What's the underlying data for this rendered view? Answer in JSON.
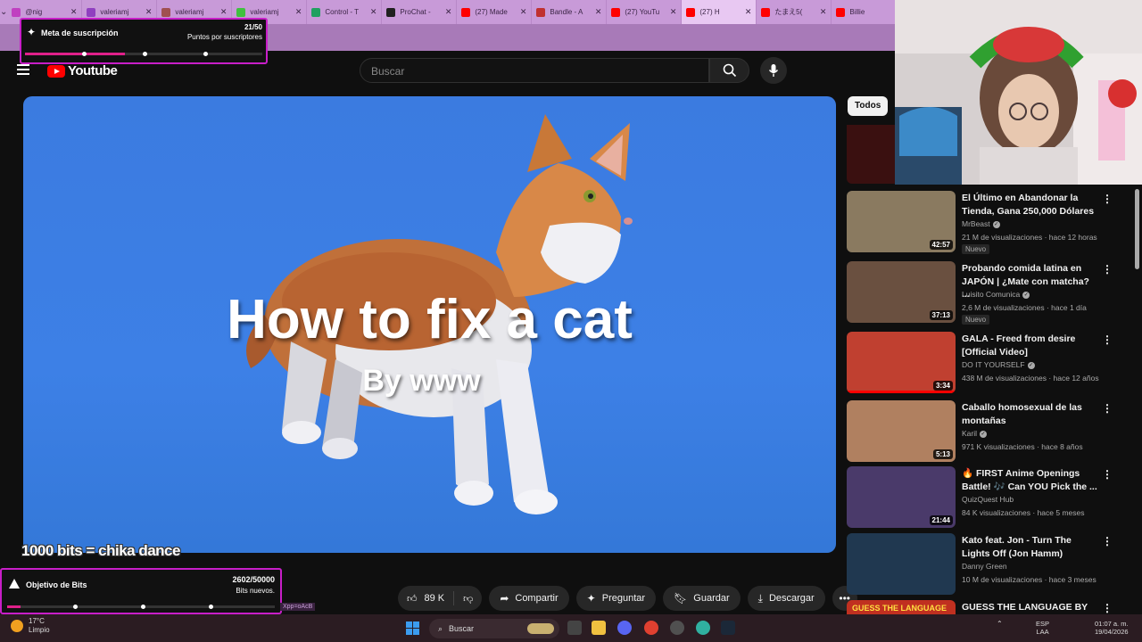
{
  "browser": {
    "tabs": [
      {
        "title": "@nig",
        "favicon": "#c040c0"
      },
      {
        "title": "valeriamj",
        "favicon": "#9040c0"
      },
      {
        "title": "valeriamj",
        "favicon": "#a05050"
      },
      {
        "title": "valeriamj",
        "favicon": "#40c040"
      },
      {
        "title": "Control - T",
        "favicon": "#20a060"
      },
      {
        "title": "ProChat -",
        "favicon": "#202020"
      },
      {
        "title": "(27) Made",
        "favicon": "#ff0000"
      },
      {
        "title": "Bandle - A",
        "favicon": "#c03030"
      },
      {
        "title": "(27) YouTu",
        "favicon": "#ff0000"
      },
      {
        "title": "(27) H",
        "favicon": "#ff0000",
        "active": true
      },
      {
        "title": "たまえ5(",
        "favicon": "#ff0000"
      },
      {
        "title": "Billie",
        "favicon": "#ff0000"
      }
    ]
  },
  "subgoal": {
    "label": "Meta de suscripción",
    "count": "21/50",
    "sub": "Puntos por suscriptores",
    "progress": 0.42
  },
  "youtube": {
    "logo": "Youtube",
    "search_placeholder": "Buscar",
    "icons": {
      "menu": "hamburger-icon",
      "search": "search-icon",
      "mic": "mic-icon"
    }
  },
  "video": {
    "title": "How to fix a cat",
    "subtitle": "By www"
  },
  "stream_overlay": {
    "bits_dance": "1000 bits = chika dance",
    "tag": "Xpp=oAcB"
  },
  "bitsgoal": {
    "label": "Objetivo de Bits",
    "count": "2602/50000",
    "sub": "Bits nuevos.",
    "progress": 0.05
  },
  "actions": {
    "likes": "89 K",
    "share": "Compartir",
    "ask": "Preguntar",
    "save": "Guardar",
    "download": "Descargar"
  },
  "sidebar": {
    "chip": "Todos",
    "recommendations": [
      {
        "title": "El Último en Abandonar la Tienda, Gana 250,000 Dólares",
        "channel": "MrBeast",
        "verified": true,
        "meta": "21 M de visualizaciones · hace 12 horas",
        "badge": "Nuevo",
        "duration": "42:57",
        "thumb": "#8a7a60",
        "progress": 0
      },
      {
        "title": "Probando comida latina en JAPÓN | ¿Mate con matcha? ...",
        "channel": "Luisito Comunica",
        "verified": true,
        "meta": "2,6 M de visualizaciones · hace 1 día",
        "badge": "Nuevo",
        "duration": "37:13",
        "thumb": "#6a5040",
        "progress": 0
      },
      {
        "title": "GALA - Freed from desire [Official Video]",
        "channel": "DO IT YOURSELF",
        "verified": true,
        "meta": "438 M de visualizaciones · hace 12 años",
        "badge": "",
        "duration": "3:34",
        "thumb": "#c04030",
        "progress": 1
      },
      {
        "title": "Caballo homosexual de las montañas",
        "channel": "Karil",
        "verified": true,
        "meta": "971 K visualizaciones · hace 8 años",
        "badge": "",
        "duration": "5:13",
        "thumb": "#b08060",
        "progress": 0
      },
      {
        "title": "🔥 FIRST Anime Openings Battle! 🎶 Can YOU Pick the ...",
        "channel": "QuizQuest Hub",
        "verified": false,
        "meta": "84 K visualizaciones · hace 5 meses",
        "badge": "",
        "duration": "21:44",
        "thumb": "#4a3a6a",
        "progress": 0
      },
      {
        "title": "Kato feat. Jon - Turn The Lights Off (Jon Hamm)",
        "channel": "Danny Green",
        "verified": false,
        "meta": "10 M de visualizaciones · hace 3 meses",
        "badge": "",
        "duration": "",
        "thumb": "#203850",
        "progress": 0
      },
      {
        "title": "GUESS THE LANGUAGE BY",
        "channel": "",
        "verified": false,
        "meta": "",
        "badge": "",
        "duration": "",
        "thumb": "#c03020",
        "thumb_text": "GUESS THE LANGUAGE",
        "progress": 0
      }
    ]
  },
  "taskbar": {
    "weather_temp": "17°C",
    "weather_desc": "Limpio",
    "search": "Buscar",
    "lang1": "ESP",
    "lang2": "LAA",
    "time": "01:07 a. m.",
    "date": "19/04/2026"
  }
}
